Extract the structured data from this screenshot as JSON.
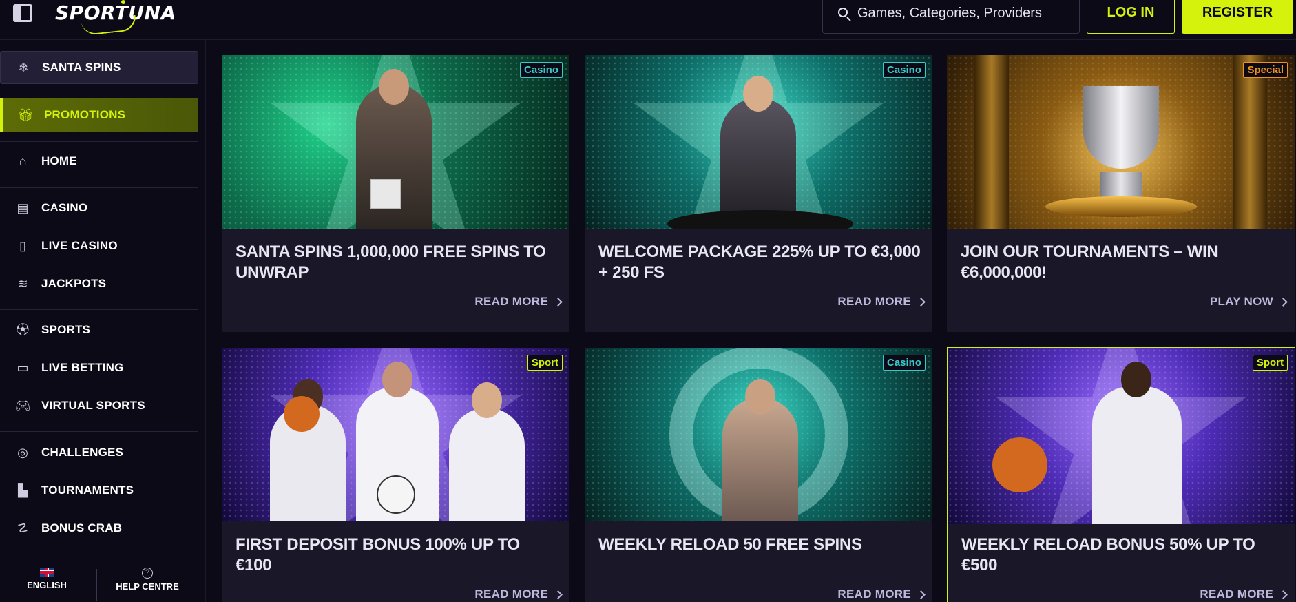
{
  "header": {
    "logo_text": "SPORTUNA",
    "search_placeholder": "Games, Categories, Providers",
    "login_label": "LOG IN",
    "register_label": "REGISTER"
  },
  "sidebar": {
    "items": [
      {
        "label": "SANTA SPINS",
        "icon": "snowflake-icon"
      },
      {
        "label": "PROMOTIONS",
        "icon": "gift-icon"
      },
      {
        "label": "HOME",
        "icon": "home-icon"
      },
      {
        "label": "CASINO",
        "icon": "slot-machine-icon"
      },
      {
        "label": "LIVE CASINO",
        "icon": "card-icon"
      },
      {
        "label": "JACKPOTS",
        "icon": "chips-icon"
      },
      {
        "label": "SPORTS",
        "icon": "soccer-ball-icon"
      },
      {
        "label": "LIVE BETTING",
        "icon": "video-camera-icon"
      },
      {
        "label": "VIRTUAL SPORTS",
        "icon": "gamepad-icon"
      },
      {
        "label": "CHALLENGES",
        "icon": "medal-icon"
      },
      {
        "label": "TOURNAMENTS",
        "icon": "podium-icon"
      },
      {
        "label": "BONUS CRAB",
        "icon": "crab-icon"
      }
    ],
    "footer": {
      "language_label": "ENGLISH",
      "help_label": "HELP CENTRE"
    }
  },
  "promotions": [
    {
      "title": "SANTA SPINS 1,000,000 FREE SPINS TO UNWRAP",
      "badge": "Casino",
      "cta": "READ MORE"
    },
    {
      "title": "WELCOME PACKAGE 225% UP TO €3,000 + 250 FS",
      "badge": "Casino",
      "cta": "READ MORE"
    },
    {
      "title": "JOIN OUR TOURNAMENTS – WIN €6,000,000!",
      "badge": "Special",
      "cta": "PLAY NOW"
    },
    {
      "title": "FIRST DEPOSIT BONUS 100% UP TO €100",
      "badge": "Sport",
      "cta": "READ MORE"
    },
    {
      "title": "WEEKLY RELOAD 50 FREE SPINS",
      "badge": "Casino",
      "cta": "READ MORE"
    },
    {
      "title": "WEEKLY RELOAD BONUS 50% UP TO €500",
      "badge": "Sport",
      "cta": "READ MORE"
    }
  ],
  "colors": {
    "accent": "#d5f20c",
    "background": "#0c0a17",
    "card": "#1a1729",
    "badge_casino": "#39c9c9",
    "badge_special": "#f2921c",
    "badge_sport": "#d5f20c"
  }
}
